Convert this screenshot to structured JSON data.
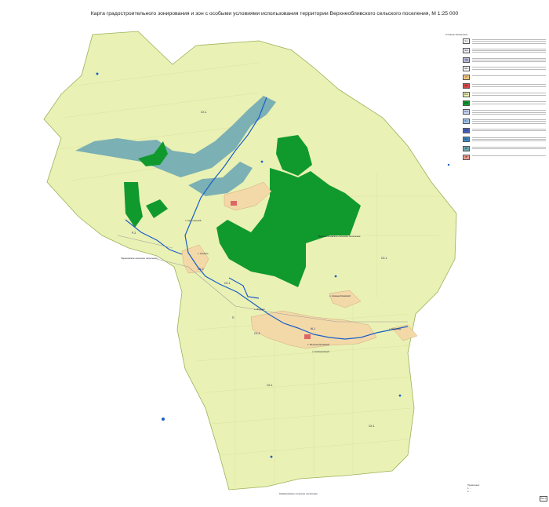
{
  "title": "Карта градостроительного зонирования и зон с особыми условиями использования территории Верхнеобливского сельского поселения, М 1:25 000",
  "colors": {
    "agri": "#eaf1b4",
    "agri_stroke": "#c9d98a",
    "forest": "#109a2d",
    "water_zone": "#6fa9b4",
    "river": "#1a5fc8",
    "settlement": "#f3d9a8",
    "settlement_dark": "#c79a72",
    "road": "#b0b0b0"
  },
  "settlements": [
    "х. Кругленький",
    "х. Гремин",
    "х. Нижнеобливский",
    "х. Верхнеобливский",
    "х. Новокрасный",
    "х. Ясенев",
    "х. Медведь"
  ],
  "region_labels": {
    "neighbor_north": "Тарасовское сельское поселение",
    "own": "Верхнеобливское сельское поселение",
    "neighbor_south": "Криворожское сельское поселение"
  },
  "zone_labels": [
    "СХ-1",
    "СХ-2",
    "СХ-3",
    "Ж-1",
    "ОД",
    "П",
    "Р-1",
    "Р-2",
    "ИТ"
  ],
  "legend": {
    "title": "Условные обозначения",
    "items": [
      {
        "code": "Ж-1"
      },
      {
        "code": "Ж-2"
      },
      {
        "code": "ОД"
      },
      {
        "code": "ОД-2"
      },
      {
        "code": "П"
      },
      {
        "code": "ИТ"
      },
      {
        "code": "СХ-1"
      },
      {
        "code": "СХ-2"
      },
      {
        "code": "СХ-3"
      },
      {
        "code": "Р-1"
      },
      {
        "code": "Р-2"
      },
      {
        "code": "Р-3"
      },
      {
        "code": "СН"
      },
      {
        "code": "ПП"
      }
    ]
  },
  "notes": [
    "Примечание:",
    "1. ...",
    "2. ..."
  ],
  "sheet": "Лист 1"
}
